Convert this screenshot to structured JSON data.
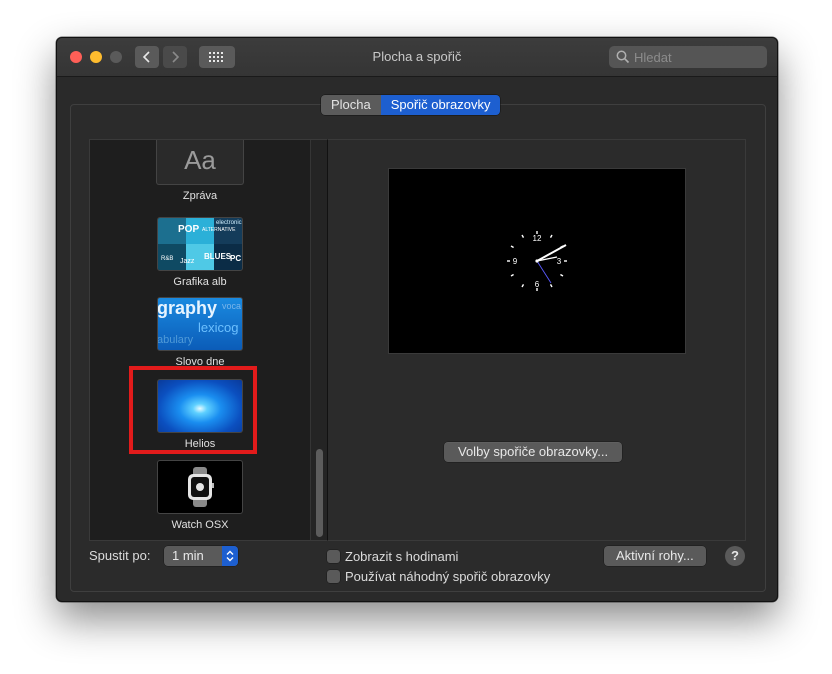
{
  "window": {
    "title": "Plocha a spořič",
    "search_placeholder": "Hledat"
  },
  "tabs": [
    {
      "label": "Plocha",
      "active": false
    },
    {
      "label": "Spořič obrazovky",
      "active": true
    }
  ],
  "savers": [
    {
      "label": "Zpráva",
      "thumb_text": "Aa",
      "icon": "message-thumbnail"
    },
    {
      "label": "Grafika alb",
      "thumb_texts": [
        "POP",
        "ALTERNATIVE",
        "electronic",
        "BLUES",
        "PC",
        "R&B",
        "Jazz"
      ],
      "icon": "album-art-thumbnail"
    },
    {
      "label": "Slovo dne",
      "thumb_texts": [
        "graphy",
        "voca",
        "lexicog",
        "abulary"
      ],
      "icon": "word-of-day-thumbnail"
    },
    {
      "label": "Helios",
      "icon": "helios-thumbnail",
      "selected": true
    },
    {
      "label": "Watch OSX",
      "icon": "watch-thumbnail"
    }
  ],
  "preview": {
    "clock_numbers": [
      "12",
      "3",
      "6",
      "9"
    ]
  },
  "options_button": "Volby spořiče obrazovky...",
  "start_after": {
    "label": "Spustit po:",
    "value": "1 min"
  },
  "checkboxes": [
    {
      "label": "Zobrazit s hodinami",
      "checked": false
    },
    {
      "label": "Používat náhodný spořič obrazovky",
      "checked": false
    }
  ],
  "hot_corners_button": "Aktivní rohy...",
  "help_button": "?",
  "colors": {
    "accent": "#1d5fd0",
    "selection_frame": "#e21b1b"
  }
}
